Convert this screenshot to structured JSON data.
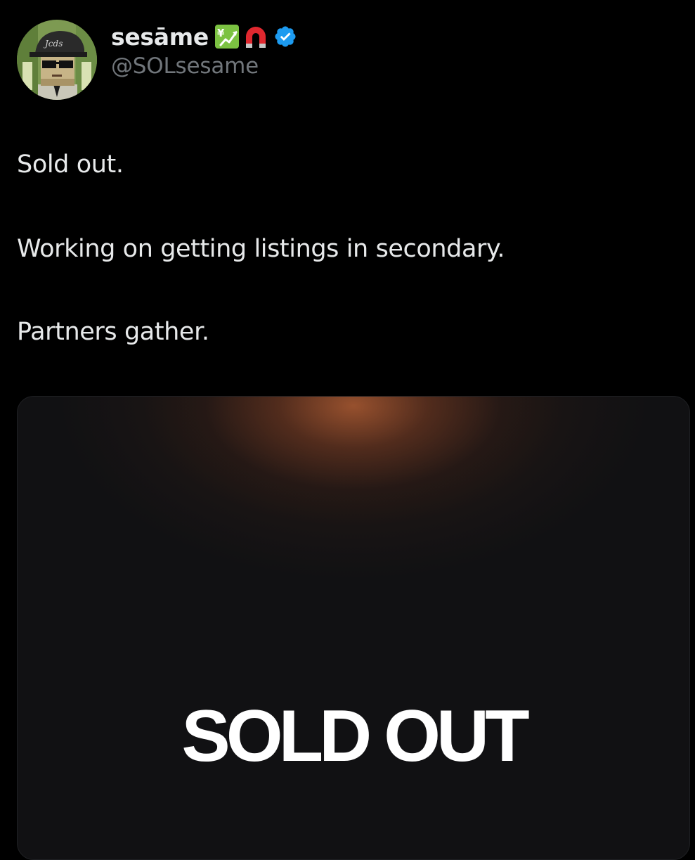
{
  "author": {
    "display_name": "sesāme",
    "handle": "@SOLsesame",
    "badges": [
      "chart-yen-emoji",
      "magnet-emoji",
      "verified-badge"
    ],
    "verified_color": "#1d9bf0"
  },
  "tweet": {
    "lines": [
      "Sold out.",
      "Working on getting listings in secondary.",
      "Partners gather."
    ]
  },
  "media": {
    "title": "SOLD OUT",
    "glow_color": "#a85a32",
    "background_color": "#111113"
  }
}
